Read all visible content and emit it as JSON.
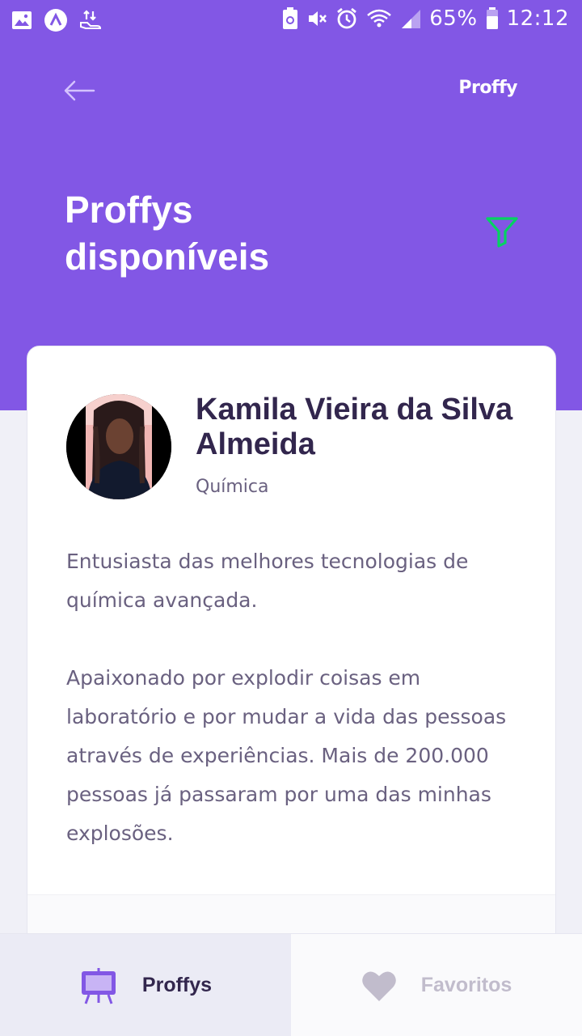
{
  "status_bar": {
    "battery_percent": "65%",
    "time": "12:12",
    "icons": [
      "gallery-icon",
      "app-icon",
      "data-transfer-icon",
      "battery-saver-icon",
      "mute-icon",
      "alarm-icon",
      "wifi-icon",
      "signal-icon",
      "battery-icon"
    ]
  },
  "header": {
    "back_icon": "arrow-left-icon",
    "logo": "Proffy",
    "title": "Proffys disponíveis",
    "filter_icon": "filter-icon",
    "colors": {
      "background": "#8257e5",
      "filter": "#04d361"
    }
  },
  "teacher_card": {
    "name": "Kamila Vieira da Silva Almeida",
    "subject": "Química",
    "bio_paragraphs": [
      "Entusiasta das melhores tecnologias de química avançada.",
      "Apaixonado por explodir coisas em laboratório e por mudar a vida das pessoas através de experiências. Mais de 200.000 pessoas já passaram por uma das minhas explosões."
    ]
  },
  "tabs": [
    {
      "label": "Proffys",
      "icon": "easel-icon",
      "active": true
    },
    {
      "label": "Favoritos",
      "icon": "heart-icon",
      "active": false
    }
  ]
}
